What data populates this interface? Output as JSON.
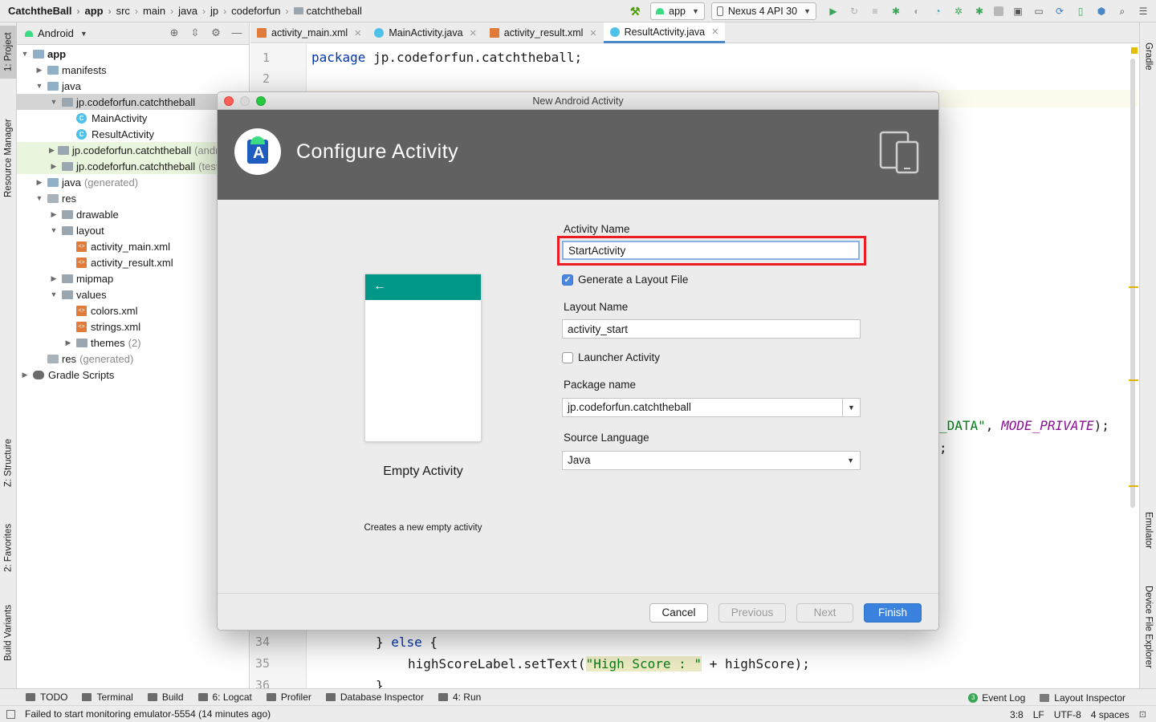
{
  "navbar": {
    "breadcrumbs": [
      "CatchtheBall",
      "app",
      "src",
      "main",
      "java",
      "jp",
      "codeforfun",
      "catchtheball"
    ],
    "run_config": "app",
    "device": "Nexus 4  API 30"
  },
  "left_tabs": [
    "1: Project",
    "Resource Manager",
    "Z: Structure",
    "2: Favorites",
    "Build Variants"
  ],
  "right_tabs": [
    "Gradle",
    "Emulator",
    "Device File Explorer"
  ],
  "project_panel": {
    "view": "Android",
    "tree": [
      {
        "label": "app",
        "depth": 0,
        "icon": "module",
        "expanded": true,
        "bold": true
      },
      {
        "label": "manifests",
        "depth": 1,
        "icon": "folder",
        "expanded": false
      },
      {
        "label": "java",
        "depth": 1,
        "icon": "folder",
        "expanded": true
      },
      {
        "label": "jp.codeforfun.catchtheball",
        "depth": 2,
        "icon": "package",
        "expanded": true,
        "selected": true
      },
      {
        "label": "MainActivity",
        "depth": 3,
        "icon": "class"
      },
      {
        "label": "ResultActivity",
        "depth": 3,
        "icon": "class"
      },
      {
        "label": "jp.codeforfun.catchtheball",
        "suffix": "(androidTest)",
        "depth": 2,
        "icon": "package",
        "expanded": false,
        "green": true
      },
      {
        "label": "jp.codeforfun.catchtheball",
        "suffix": "(test)",
        "depth": 2,
        "icon": "package",
        "expanded": false,
        "green": true
      },
      {
        "label": "java",
        "suffix": "(generated)",
        "depth": 1,
        "icon": "folder",
        "expanded": false
      },
      {
        "label": "res",
        "depth": 1,
        "icon": "res",
        "expanded": true
      },
      {
        "label": "drawable",
        "depth": 2,
        "icon": "package",
        "expanded": false
      },
      {
        "label": "layout",
        "depth": 2,
        "icon": "package",
        "expanded": true
      },
      {
        "label": "activity_main.xml",
        "depth": 3,
        "icon": "xml"
      },
      {
        "label": "activity_result.xml",
        "depth": 3,
        "icon": "xml"
      },
      {
        "label": "mipmap",
        "depth": 2,
        "icon": "package",
        "expanded": false
      },
      {
        "label": "values",
        "depth": 2,
        "icon": "package",
        "expanded": true
      },
      {
        "label": "colors.xml",
        "depth": 3,
        "icon": "xml"
      },
      {
        "label": "strings.xml",
        "depth": 3,
        "icon": "xml"
      },
      {
        "label": "themes",
        "suffix": "(2)",
        "depth": 3,
        "icon": "package",
        "expanded": false
      },
      {
        "label": "res",
        "suffix": "(generated)",
        "depth": 1,
        "icon": "res"
      },
      {
        "label": "Gradle Scripts",
        "depth": 0,
        "icon": "gradle",
        "expanded": false
      }
    ]
  },
  "editor": {
    "tabs": [
      {
        "label": "activity_main.xml",
        "type": "xml",
        "active": false
      },
      {
        "label": "MainActivity.java",
        "type": "class",
        "active": false
      },
      {
        "label": "activity_result.xml",
        "type": "xml",
        "active": false
      },
      {
        "label": "ResultActivity.java",
        "type": "class",
        "active": true
      }
    ],
    "line_numbers": [
      "1",
      "2",
      "34",
      "35",
      "36"
    ],
    "line1_kw": "package",
    "line1_rest": " jp.codeforfun.catchtheball;",
    "frag_str": "_DATA\"",
    "frag_sep": ", ",
    "frag_ital": "MODE_PRIVATE",
    "frag_end": ");",
    "frag_semi": ";",
    "line34_brace": "} ",
    "line34_kw": "else",
    "line34_end": " {",
    "line35_a": "highScoreLabel.setText(",
    "line35_str": "\"High Score : \"",
    "line35_b": " + highScore);",
    "line36": "}"
  },
  "dialog": {
    "window_title": "New Android Activity",
    "banner_title": "Configure Activity",
    "template_name": "Empty Activity",
    "template_desc": "Creates a new empty activity",
    "activity_name_label": "Activity Name",
    "activity_name_value": "StartActivity",
    "generate_layout_label": "Generate a Layout File",
    "generate_layout_checked": true,
    "layout_name_label": "Layout Name",
    "layout_name_value": "activity_start",
    "launcher_label": "Launcher Activity",
    "launcher_checked": false,
    "package_label": "Package name",
    "package_value": "jp.codeforfun.catchtheball",
    "language_label": "Source Language",
    "language_value": "Java",
    "buttons": {
      "cancel": "Cancel",
      "previous": "Previous",
      "next": "Next",
      "finish": "Finish"
    }
  },
  "toolwindows": [
    {
      "label": "TODO"
    },
    {
      "label": "Terminal"
    },
    {
      "label": "Build"
    },
    {
      "label": "6: Logcat"
    },
    {
      "label": "Profiler"
    },
    {
      "label": "Database Inspector"
    },
    {
      "label": "4: Run"
    }
  ],
  "toolwindows_right": [
    "Event Log",
    "Layout Inspector"
  ],
  "event_count": "3",
  "status": {
    "message": "Failed to start monitoring emulator-5554 (14 minutes ago)",
    "position": "3:8",
    "line_sep": "LF",
    "encoding": "UTF-8",
    "indent": "4 spaces"
  },
  "colors": {
    "accent": "#3a82dd",
    "highlight": "#ec1c24",
    "toolbar_teal": "#009688"
  }
}
